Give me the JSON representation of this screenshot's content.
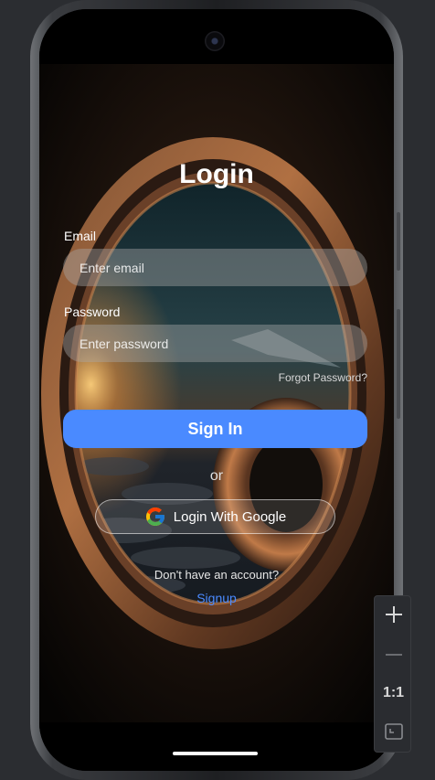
{
  "login": {
    "title": "Login",
    "email_label": "Email",
    "email_placeholder": "Enter email",
    "email_value": "",
    "password_label": "Password",
    "password_placeholder": "Enter password",
    "password_value": "",
    "forgot_label": "Forgot Password?",
    "signin_label": "Sign In",
    "or_label": "or",
    "google_label": "Login With Google",
    "no_account_text": "Don't have an account?",
    "signup_label": "Signup"
  },
  "zoom_controls": {
    "zoom_in_icon": "plus-icon",
    "zoom_out_icon": "minus-icon",
    "actual_size_label": "1:1",
    "fit_icon": "fit-screen-icon"
  },
  "colors": {
    "accent": "#4a8aff",
    "background": "#2b2d31"
  }
}
